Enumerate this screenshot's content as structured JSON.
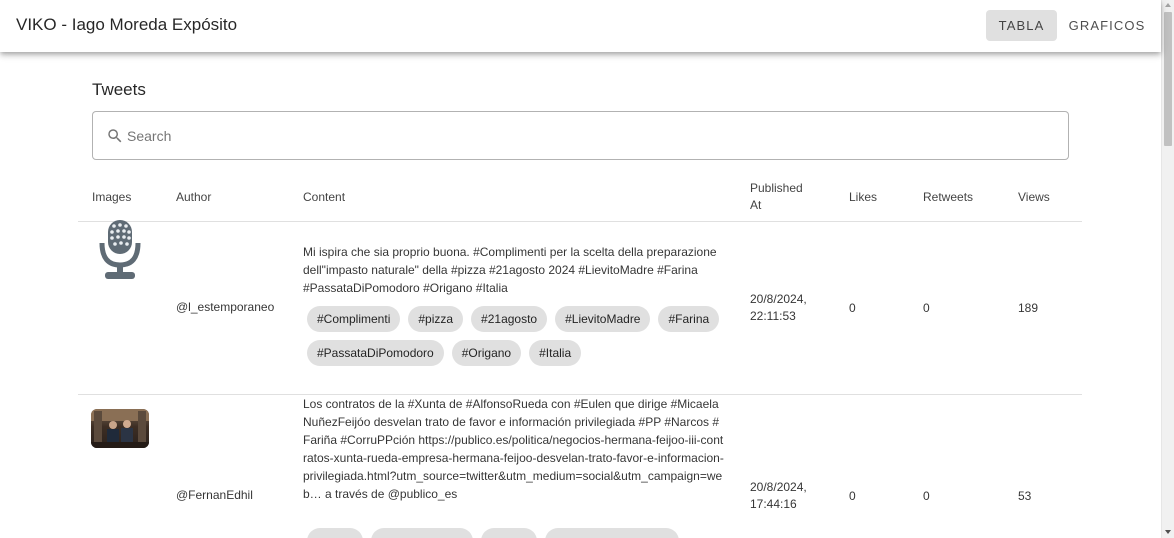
{
  "app": {
    "title": "VIKO - Iago Moreda Expósito",
    "nav": [
      "TABLA",
      "GRAFICOS"
    ]
  },
  "section_title": "Tweets",
  "search": {
    "placeholder": "Search",
    "value": ""
  },
  "table": {
    "columns": [
      "Images",
      "Author",
      "Content",
      "Published At",
      "Likes",
      "Retweets",
      "Views"
    ],
    "rows": [
      {
        "image": "microphone-icon",
        "author": "@l_estemporaneo",
        "content": "Mi ispira che sia proprio buona. #Complimenti per la scelta della preparazione dell\"impasto naturale\" della #pizza #21agosto 2024 #LievitoMadre #Farina #PassataDiPomodoro #Origano #Italia",
        "tags": [
          "#Complimenti",
          "#pizza",
          "#21agosto",
          "#LievitoMadre",
          "#Farina",
          "#PassataDiPomodoro",
          "#Origano",
          "#Italia"
        ],
        "published_at": "20/8/2024, 22:11:53",
        "likes": "0",
        "retweets": "0",
        "views": "189"
      },
      {
        "image": "tweet-photo",
        "author": "@FernanEdhil",
        "content": "Los contratos de la #Xunta de #AlfonsoRueda con #Eulen que dirige #MicaelaNuñezFeijóo desvelan trato de favor e información privilegiada #PP #Narcos #Fariña #CorruPPción https://publico.es/politica/negocios-hermana-feijoo-iii-contratos-xunta-rueda-empresa-hermana-feijoo-desvelan-trato-favor-e-informacion-privilegiada.html?utm_source=twitter&utm_medium=social&utm_campaign=web… a través de @publico_es",
        "published_at": "20/8/2024, 17:44:16",
        "likes": "0",
        "retweets": "0",
        "views": "53"
      }
    ]
  }
}
